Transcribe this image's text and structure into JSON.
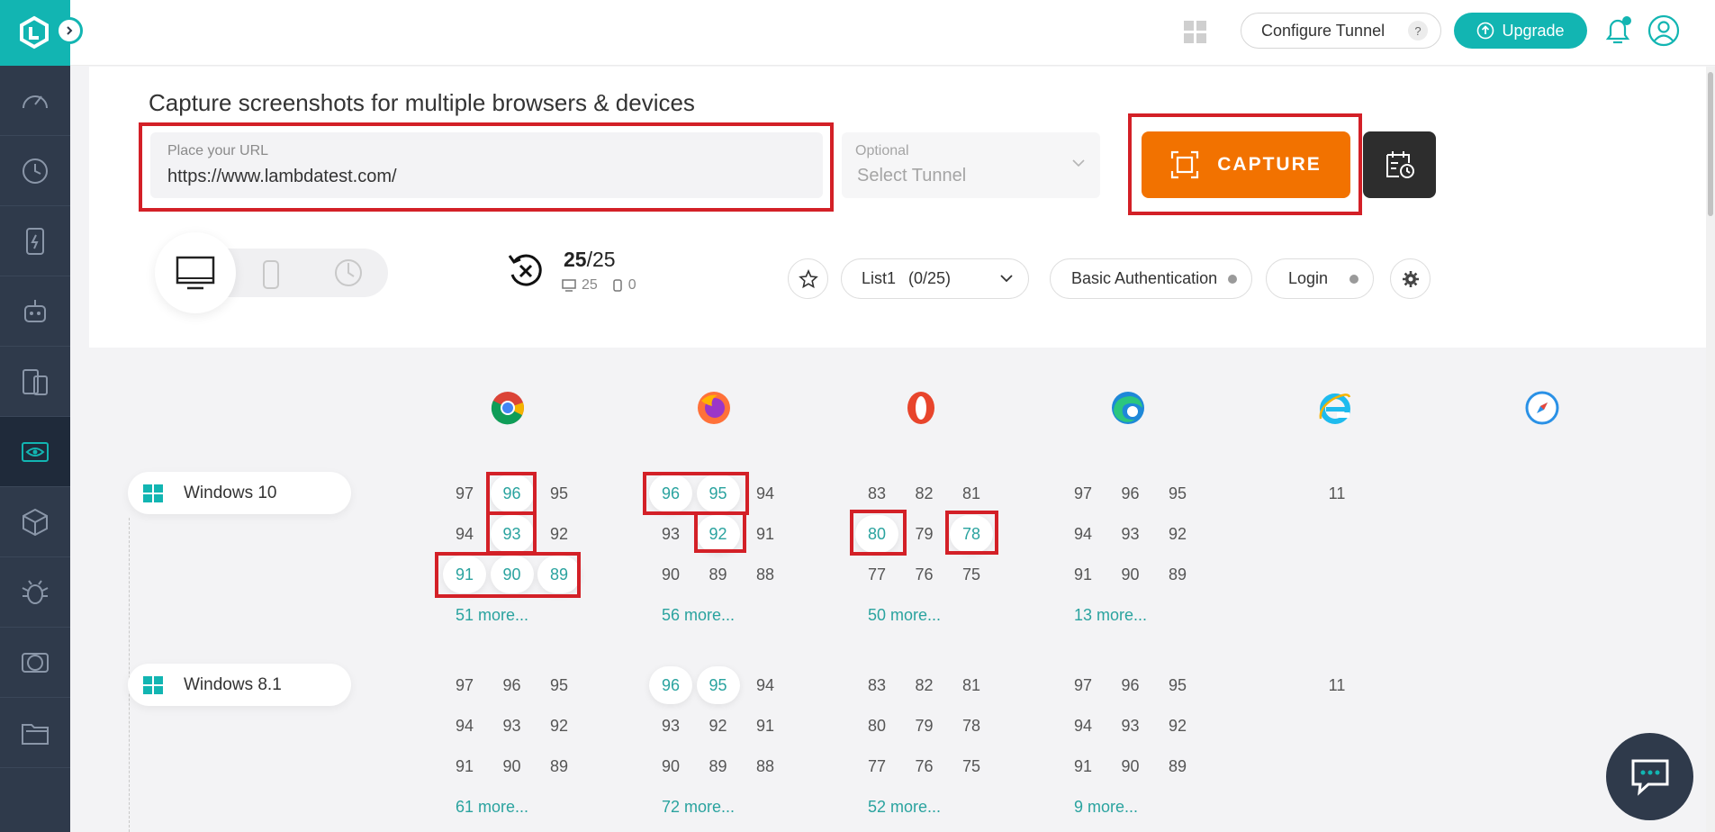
{
  "topbar": {
    "configure_tunnel": "Configure Tunnel",
    "help_mark": "?",
    "upgrade": "Upgrade"
  },
  "sidebar": {
    "items": [
      "speedometer-icon",
      "realtime-icon",
      "app-test-icon",
      "automation-robot-icon",
      "responsive-icon",
      "visual-eye-icon",
      "box-icon",
      "bug-icon",
      "smart-ui-icon",
      "folder-icon"
    ],
    "active_index": 5
  },
  "capture": {
    "heading": "Capture screenshots for multiple browsers & devices",
    "url_label": "Place your URL",
    "url_value": "https://www.lambdatest.com/",
    "tunnel_label": "Optional",
    "tunnel_placeholder": "Select Tunnel",
    "capture_label": "CAPTURE"
  },
  "counter": {
    "used": "25",
    "total": "/25",
    "desktop_count": "25",
    "mobile_count": "0"
  },
  "toolbar": {
    "list_name": "List1",
    "list_count": "(0/25)",
    "basic_auth": "Basic Authentication",
    "login": "Login"
  },
  "browsers": [
    "chrome",
    "firefox",
    "opera",
    "edge",
    "internet-explorer",
    "safari"
  ],
  "os_rows": [
    {
      "name": "Windows 10",
      "chrome": {
        "versions": [
          "97",
          "96",
          "95",
          "94",
          "93",
          "92",
          "91",
          "90",
          "89"
        ],
        "selected": [
          "96",
          "93",
          "91",
          "90",
          "89"
        ],
        "more": "51 more..."
      },
      "firefox": {
        "versions": [
          "96",
          "95",
          "94",
          "93",
          "92",
          "91",
          "90",
          "89",
          "88"
        ],
        "selected": [
          "96",
          "95",
          "92"
        ],
        "more": "56 more..."
      },
      "opera": {
        "versions": [
          "83",
          "82",
          "81",
          "80",
          "79",
          "78",
          "77",
          "76",
          "75"
        ],
        "selected": [
          "80",
          "78"
        ],
        "more": "50 more..."
      },
      "edge": {
        "versions": [
          "97",
          "96",
          "95",
          "94",
          "93",
          "92",
          "91",
          "90",
          "89"
        ],
        "selected": [],
        "more": "13 more..."
      },
      "ie": {
        "versions": [
          "11"
        ],
        "selected": []
      }
    },
    {
      "name": "Windows 8.1",
      "chrome": {
        "versions": [
          "97",
          "96",
          "95",
          "94",
          "93",
          "92",
          "91",
          "90",
          "89"
        ],
        "selected": [],
        "more": "61 more..."
      },
      "firefox": {
        "versions": [
          "96",
          "95",
          "94",
          "93",
          "92",
          "91",
          "90",
          "89",
          "88"
        ],
        "selected": [
          "96",
          "95"
        ],
        "more": "72 more..."
      },
      "opera": {
        "versions": [
          "83",
          "82",
          "81",
          "80",
          "79",
          "78",
          "77",
          "76",
          "75"
        ],
        "selected": [],
        "more": "52 more..."
      },
      "edge": {
        "versions": [
          "97",
          "96",
          "95",
          "94",
          "93",
          "92",
          "91",
          "90",
          "89"
        ],
        "selected": [],
        "more": "9 more..."
      },
      "ie": {
        "versions": [
          "11"
        ],
        "selected": []
      }
    }
  ],
  "colors": {
    "accent": "#12b5b2",
    "capture": "#f27200",
    "sidebar": "#2f3a4b",
    "highlight_box": "#d32027"
  }
}
